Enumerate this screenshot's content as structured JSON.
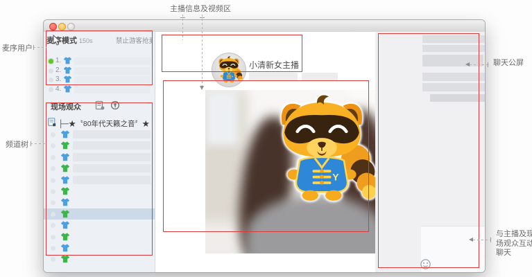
{
  "annotations": {
    "video_info": "主播信息及视频区",
    "mic_users": "麦序用户",
    "channel_tree": "频道树",
    "public_chat": "聊天公屏",
    "interact_chat": "与主播及现场观众互动聊天"
  },
  "mic_panel": {
    "title": "麦序模式",
    "timer": "150s",
    "hint": "禁止游客抢麦",
    "queue": [
      {
        "num": "1.",
        "active": true,
        "shirt": "blue"
      },
      {
        "num": "2.",
        "active": false,
        "shirt": "blue"
      },
      {
        "num": "3.",
        "active": false,
        "shirt": "blue"
      },
      {
        "num": "4.",
        "active": false,
        "shirt": "blue"
      }
    ]
  },
  "audience_panel": {
    "title": "现场观众"
  },
  "tree_panel": {
    "title": "├─★〝80年代天籁之音〞★",
    "rows": [
      {
        "shirt": "blue",
        "bar": true,
        "selected": false
      },
      {
        "shirt": "green",
        "bar": true,
        "selected": false
      },
      {
        "shirt": "blue",
        "bar": true,
        "selected": false
      },
      {
        "shirt": "green",
        "bar": true,
        "selected": false
      },
      {
        "shirt": "blue",
        "bar": true,
        "selected": false
      },
      {
        "shirt": "green",
        "bar": false,
        "selected": false
      },
      {
        "shirt": "blue",
        "bar": false,
        "selected": false
      },
      {
        "shirt": "green",
        "bar": false,
        "selected": true
      },
      {
        "shirt": "blue",
        "bar": false,
        "selected": false
      },
      {
        "shirt": "green",
        "bar": false,
        "selected": false
      },
      {
        "shirt": "blue",
        "bar": false,
        "selected": false
      },
      {
        "shirt": "green",
        "bar": false,
        "selected": false
      }
    ]
  },
  "anchor": {
    "name": "小清新女主播"
  },
  "icons": {
    "roster": "roster-icon",
    "location": "location-pin-icon",
    "tree_node": "channel-node-icon",
    "smiley": "smiley-emoticon-icon",
    "resize": "resize-arrows-icon",
    "mascot": "yy-mascot",
    "cursor": "mouse-cursor"
  },
  "colors": {
    "annotation_red": "#dc3a3a",
    "shirt_blue": "#4aa0e0",
    "shirt_green": "#3cb54b",
    "active_dot": "#62c42c"
  }
}
